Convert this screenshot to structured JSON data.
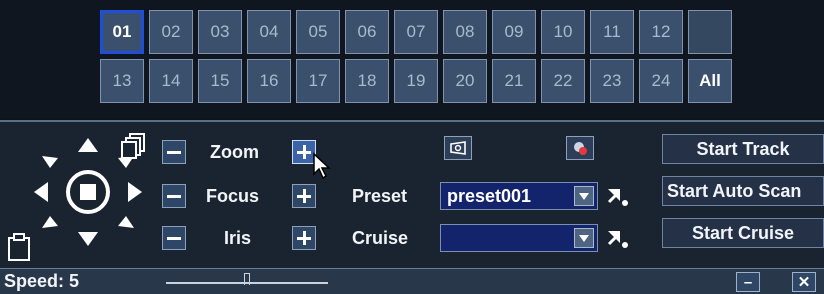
{
  "channels": {
    "row1": [
      "01",
      "02",
      "03",
      "04",
      "05",
      "06",
      "07",
      "08",
      "09",
      "10",
      "11",
      "12",
      ""
    ],
    "row2": [
      "13",
      "14",
      "15",
      "16",
      "17",
      "18",
      "19",
      "20",
      "21",
      "22",
      "23",
      "24",
      "All"
    ],
    "selected": "01"
  },
  "ptz": {
    "zoom_label": "Zoom",
    "focus_label": "Focus",
    "iris_label": "Iris"
  },
  "preset": {
    "label": "Preset",
    "value": "preset001"
  },
  "cruise": {
    "label": "Cruise",
    "value": ""
  },
  "actions": {
    "start_track": "Start Track",
    "start_auto_scan": "Start Auto Scan",
    "start_cruise": "Start Cruise"
  },
  "speed": {
    "label": "Speed: 5",
    "value": 5,
    "level_fraction": 0.5
  },
  "window": {
    "minimize": "–",
    "close": "✕"
  },
  "icons": [
    "ptz-up-icon",
    "ptz-down-icon",
    "ptz-left-icon",
    "ptz-right-icon",
    "ptz-stop-icon",
    "copy-icon",
    "paste-icon",
    "camera-view-icon",
    "record-dot-icon",
    "goto-preset-icon",
    "goto-cruise-icon",
    "mouse-cursor-icon"
  ],
  "colors": {
    "accent_selected": "#1f4fd6",
    "channel_bg": "#3a506d",
    "dropdown_bg": "#13246c"
  }
}
